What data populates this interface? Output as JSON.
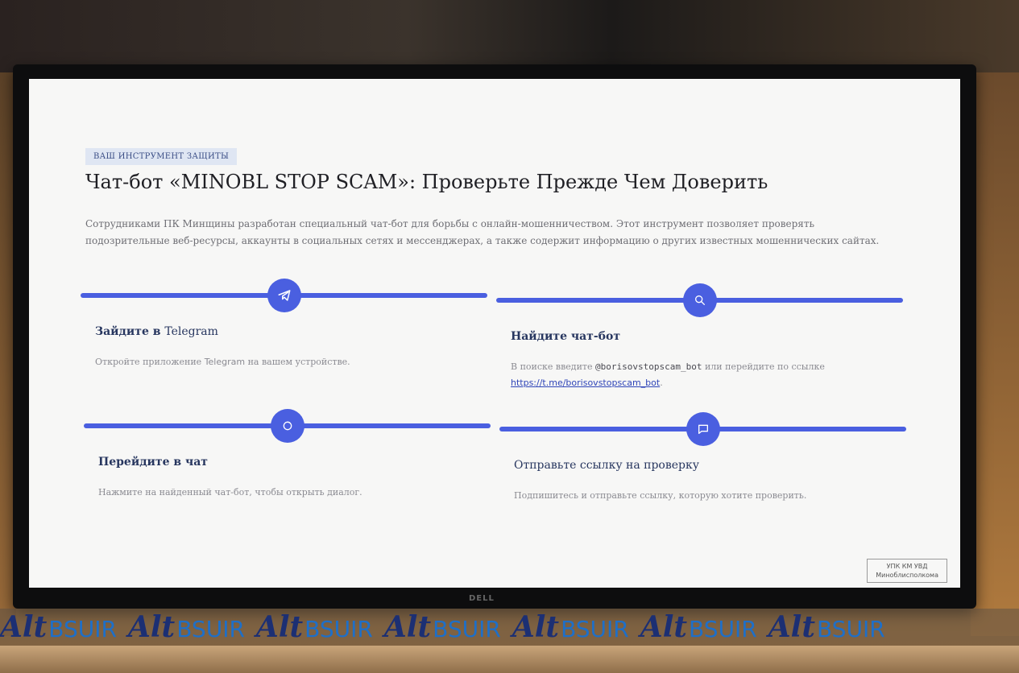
{
  "screen": {
    "eyebrow": "ВАШ ИНСТРУМЕНТ ЗАЩИТЫ",
    "title": "Чат-бот «MINOBL STOP SCAM»: Проверьте Прежде Чем Доверить",
    "intro": "Сотрудниками ПК Минщины разработан специальный чат-бот для борьбы с онлайн-мошенничеством. Этот инструмент позволяет проверять подозрительные веб-ресурсы, аккаунты в социальных сетях и мессенджерах, а также содержит информацию о других известных мошеннических сайтах.",
    "steps": [
      {
        "icon": "telegram-icon",
        "title_a": "Зайдите в ",
        "title_b": "Telegram",
        "desc_a": "Откройте приложение ",
        "desc_b": "Telegram",
        "desc_c": " на вашем устройстве."
      },
      {
        "icon": "search-icon",
        "title": "Найдите чат-бот",
        "desc_a": "В поиске введите ",
        "desc_handle": "@borisovstopscam_bot",
        "desc_b": " или перейдите по ссылке ",
        "link": "https://t.me/borisovstopscam_bot",
        "desc_c": "."
      },
      {
        "icon": "chat-open-icon",
        "title": "Перейдите в чат",
        "desc": "Нажмите на найденный чат-бот, чтобы открыть диалог."
      },
      {
        "icon": "message-icon",
        "title": "Отправьте ссылку на проверку",
        "desc": "Подпишитесь и отправьте ссылку, которую хотите проверить."
      }
    ],
    "stamp_line1": "УПК КМ УВД",
    "stamp_line2": "Миноблисполкома"
  },
  "monitor": {
    "brand": "DELL"
  },
  "watermark": {
    "logo": "Alt",
    "text": "BSUIR",
    "repeat": 7
  },
  "colors": {
    "accent": "#4a5fe0",
    "heading": "#27365f",
    "link": "#2f45b8"
  }
}
